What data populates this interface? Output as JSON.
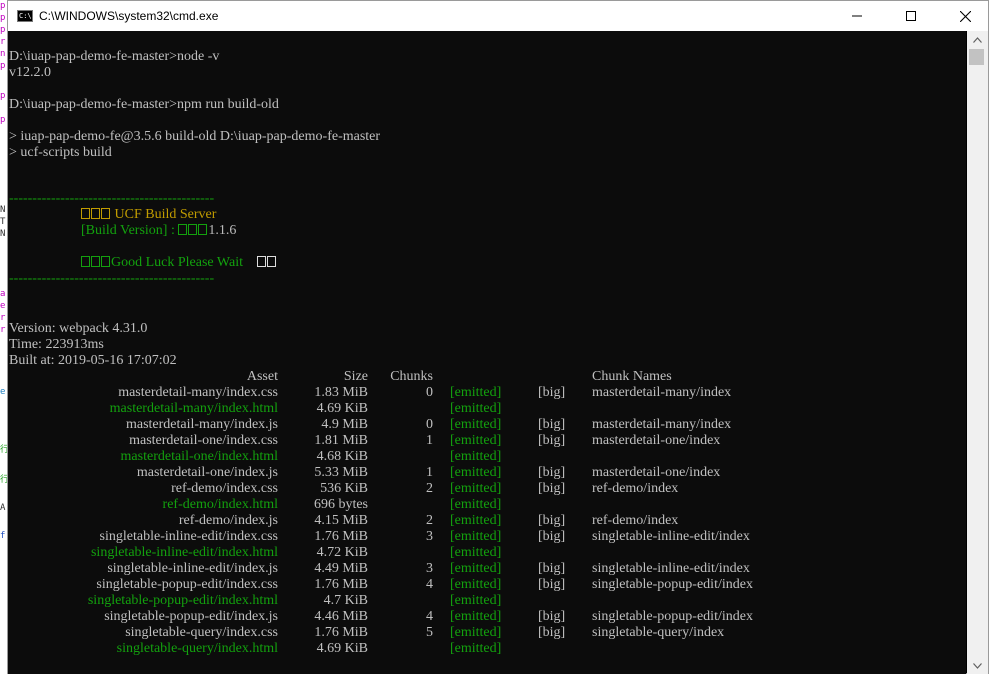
{
  "window": {
    "title": "C:\\WINDOWS\\system32\\cmd.exe",
    "icon_text": "C:\\"
  },
  "left_strip": [
    "p",
    "p",
    "p",
    "r",
    "n",
    "p",
    "",
    "p",
    "",
    "p",
    "",
    "N",
    "T",
    "N",
    "",
    "a",
    "e",
    "r",
    "r",
    "",
    "",
    "e",
    "",
    "",
    "行",
    "",
    "行",
    "",
    "A",
    "",
    "f"
  ],
  "console": {
    "prompt1": "D:\\iuap-pap-demo-fe-master>node -v",
    "node_version": "v12.2.0",
    "prompt2": "D:\\iuap-pap-demo-fe-master>npm run build-old",
    "script_line1": "> iuap-pap-demo-fe@3.5.6 build-old D:\\iuap-pap-demo-fe-master",
    "script_line2": "> ucf-scripts build",
    "divider": "--------------------------------------------",
    "banner_title": " UCF Build Server",
    "banner_version_label": "[Build Version] : ",
    "banner_version_value": "1.1.6",
    "banner_wait": "Good Luck Please Wait",
    "webpack_version": "Version: webpack 4.31.0",
    "time": "Time: 223913ms",
    "built_at": "Built at: 2019-05-16 17:07:02",
    "headers": {
      "asset": "Asset",
      "size": "Size",
      "chunks": "Chunks",
      "chunk_names": "Chunk Names"
    },
    "rows": [
      {
        "asset": "masterdetail-many/index.css",
        "size": "1.83 MiB",
        "chunks": "0",
        "emitted": "[emitted]",
        "big": "[big]",
        "names": "masterdetail-many/index",
        "html": false
      },
      {
        "asset": "masterdetail-many/index.html",
        "size": "4.69 KiB",
        "chunks": "",
        "emitted": "[emitted]",
        "big": "",
        "names": "",
        "html": true
      },
      {
        "asset": "masterdetail-many/index.js",
        "size": "4.9 MiB",
        "chunks": "0",
        "emitted": "[emitted]",
        "big": "[big]",
        "names": "masterdetail-many/index",
        "html": false
      },
      {
        "asset": "masterdetail-one/index.css",
        "size": "1.81 MiB",
        "chunks": "1",
        "emitted": "[emitted]",
        "big": "[big]",
        "names": "masterdetail-one/index",
        "html": false
      },
      {
        "asset": "masterdetail-one/index.html",
        "size": "4.68 KiB",
        "chunks": "",
        "emitted": "[emitted]",
        "big": "",
        "names": "",
        "html": true
      },
      {
        "asset": "masterdetail-one/index.js",
        "size": "5.33 MiB",
        "chunks": "1",
        "emitted": "[emitted]",
        "big": "[big]",
        "names": "masterdetail-one/index",
        "html": false
      },
      {
        "asset": "ref-demo/index.css",
        "size": "536 KiB",
        "chunks": "2",
        "emitted": "[emitted]",
        "big": "[big]",
        "names": "ref-demo/index",
        "html": false
      },
      {
        "asset": "ref-demo/index.html",
        "size": "696 bytes",
        "chunks": "",
        "emitted": "[emitted]",
        "big": "",
        "names": "",
        "html": true
      },
      {
        "asset": "ref-demo/index.js",
        "size": "4.15 MiB",
        "chunks": "2",
        "emitted": "[emitted]",
        "big": "[big]",
        "names": "ref-demo/index",
        "html": false
      },
      {
        "asset": "singletable-inline-edit/index.css",
        "size": "1.76 MiB",
        "chunks": "3",
        "emitted": "[emitted]",
        "big": "[big]",
        "names": "singletable-inline-edit/index",
        "html": false
      },
      {
        "asset": "singletable-inline-edit/index.html",
        "size": "4.72 KiB",
        "chunks": "",
        "emitted": "[emitted]",
        "big": "",
        "names": "",
        "html": true
      },
      {
        "asset": "singletable-inline-edit/index.js",
        "size": "4.49 MiB",
        "chunks": "3",
        "emitted": "[emitted]",
        "big": "[big]",
        "names": "singletable-inline-edit/index",
        "html": false
      },
      {
        "asset": "singletable-popup-edit/index.css",
        "size": "1.76 MiB",
        "chunks": "4",
        "emitted": "[emitted]",
        "big": "[big]",
        "names": "singletable-popup-edit/index",
        "html": false
      },
      {
        "asset": "singletable-popup-edit/index.html",
        "size": "4.7 KiB",
        "chunks": "",
        "emitted": "[emitted]",
        "big": "",
        "names": "",
        "html": true
      },
      {
        "asset": "singletable-popup-edit/index.js",
        "size": "4.46 MiB",
        "chunks": "4",
        "emitted": "[emitted]",
        "big": "[big]",
        "names": "singletable-popup-edit/index",
        "html": false
      },
      {
        "asset": "singletable-query/index.css",
        "size": "1.76 MiB",
        "chunks": "5",
        "emitted": "[emitted]",
        "big": "[big]",
        "names": "singletable-query/index",
        "html": false
      },
      {
        "asset": "singletable-query/index.html",
        "size": "4.69 KiB",
        "chunks": "",
        "emitted": "[emitted]",
        "big": "",
        "names": "",
        "html": true
      }
    ]
  },
  "colors": {
    "console_bg": "#0c0c0c",
    "console_text": "#c0c0c0",
    "green": "#13a10e",
    "orange": "#c19c00"
  },
  "icons": {
    "minimize": "minimize-icon",
    "maximize": "maximize-icon",
    "close": "close-icon",
    "scroll_up": "arrow-up-icon",
    "scroll_down": "arrow-down-icon"
  }
}
